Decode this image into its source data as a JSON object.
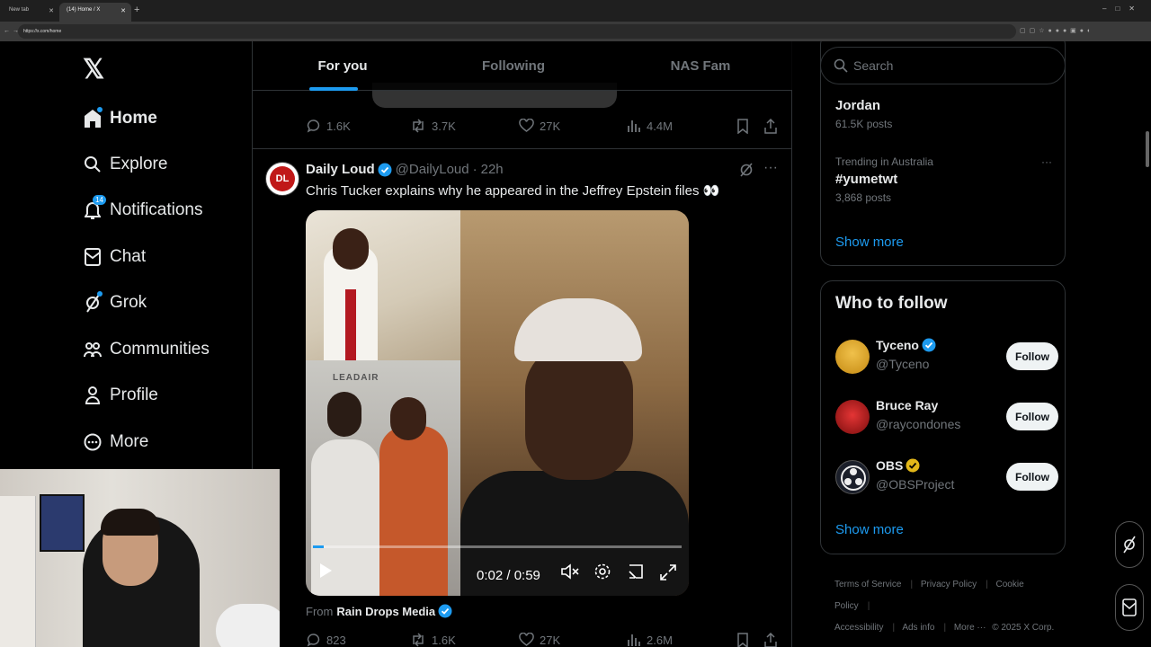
{
  "browser": {
    "tabs": [
      {
        "label": "New tab"
      },
      {
        "label": "(14) Home / X"
      }
    ],
    "url": "https://x.com/home"
  },
  "nav": {
    "items": [
      {
        "label": "Home",
        "icon": "home-icon"
      },
      {
        "label": "Explore",
        "icon": "search-icon"
      },
      {
        "label": "Notifications",
        "icon": "bell-icon",
        "badge": "14"
      },
      {
        "label": "Chat",
        "icon": "envelope-icon"
      },
      {
        "label": "Grok",
        "icon": "grok-icon"
      },
      {
        "label": "Communities",
        "icon": "people-icon"
      },
      {
        "label": "Profile",
        "icon": "person-icon"
      },
      {
        "label": "More",
        "icon": "more-circle-icon"
      }
    ]
  },
  "feed": {
    "tabs": [
      {
        "label": "For you",
        "active": true
      },
      {
        "label": "Following"
      },
      {
        "label": "NAS Fam"
      }
    ],
    "prev_post": {
      "replies": "1.6K",
      "reposts": "3.7K",
      "likes": "27K",
      "views": "4.4M"
    },
    "post": {
      "name": "Daily Loud",
      "handle": "@DailyLoud",
      "time": "22h",
      "text": "Chris Tucker explains why he appeared in the Jeffrey Epstein files 👀",
      "video_time": "0:02 / 0:59",
      "video_progress": 0.03,
      "media_sign": "LEADAIR",
      "avatar_text": "DL",
      "from_prefix": "From",
      "from_name": "Rain Drops Media",
      "replies": "823",
      "reposts": "1.6K",
      "likes": "27K",
      "views": "2.6M"
    }
  },
  "sidebar": {
    "search_placeholder": "Search",
    "trends": [
      {
        "title": "Jordan",
        "count": "61.5K posts"
      },
      {
        "meta": "Trending in Australia",
        "title": "#yumetwt",
        "count": "3,868 posts"
      }
    ],
    "show_more": "Show more",
    "who_to_follow": {
      "heading": "Who to follow",
      "users": [
        {
          "name": "Tyceno",
          "handle": "@Tyceno",
          "verified": "blue",
          "button": "Follow"
        },
        {
          "name": "Bruce Ray",
          "handle": "@raycondones",
          "button": "Follow"
        },
        {
          "name": "OBS",
          "handle": "@OBSProject",
          "verified": "gold",
          "button": "Follow"
        }
      ],
      "show_more": "Show more"
    },
    "footer": {
      "links": [
        "Terms of Service",
        "Privacy Policy",
        "Cookie Policy",
        "Accessibility",
        "Ads info",
        "More ···"
      ],
      "copyright": "© 2025 X Corp."
    }
  },
  "colors": {
    "accent": "#1d9bf0",
    "background": "#000000",
    "text": "#e7e9ea",
    "muted": "#71767b",
    "border": "#2f3336",
    "gold_badge": "#e2b719"
  }
}
